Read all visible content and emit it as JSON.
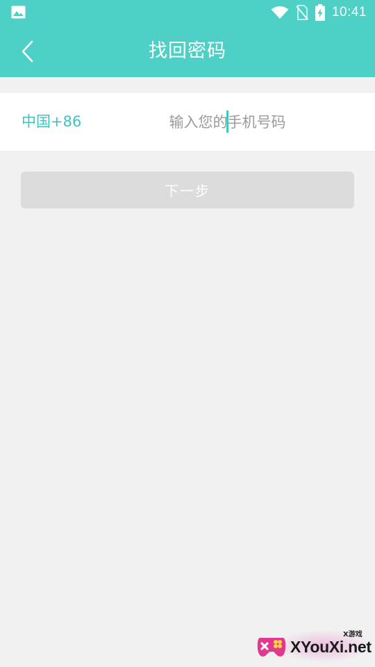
{
  "status_bar": {
    "time": "10:41",
    "icons": [
      "image-icon",
      "wifi-icon",
      "no-sim-icon",
      "battery-charging-icon"
    ]
  },
  "header": {
    "title": "找回密码",
    "back_icon": "chevron-left-icon",
    "background": "#4fd0c6"
  },
  "phone_form": {
    "country_code": "中国+86",
    "phone_placeholder": "输入您的手机号码",
    "phone_value": ""
  },
  "next_button": {
    "label": "下一步",
    "enabled": false
  },
  "watermark": {
    "tag": "X游戏",
    "text": "XYouXi.net"
  },
  "colors": {
    "accent": "#4fd0c6",
    "country_code": "#3fc2c2",
    "page_background": "#f1f1f1",
    "disabled_button": "#dcdcdc"
  }
}
